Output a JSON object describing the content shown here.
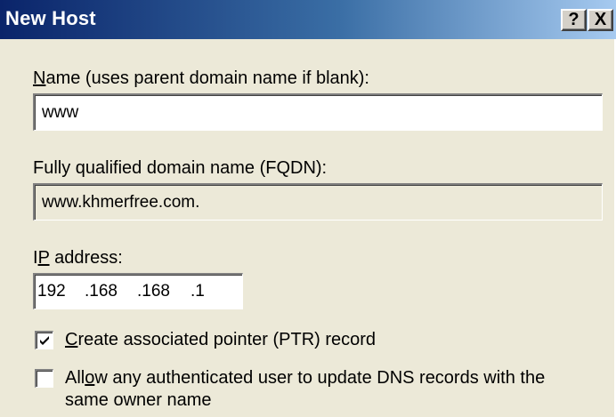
{
  "window": {
    "title": "New Host",
    "help_button": "?",
    "close_button": "X"
  },
  "name_field": {
    "label_mnemonic": "N",
    "label_rest": "ame (uses parent domain name if blank):",
    "value": "www"
  },
  "fqdn_field": {
    "label": "Fully qualified domain name (FQDN):",
    "value": "www.khmerfree.com."
  },
  "ip_field": {
    "label_pre": "I",
    "label_mnemonic": "P",
    "label_rest": " address:",
    "octets": [
      "192",
      ".168",
      ".168",
      ".1"
    ]
  },
  "ptr_checkbox": {
    "checked": true,
    "label_mnemonic": "C",
    "label_rest": "reate associated pointer (PTR) record"
  },
  "update_checkbox": {
    "checked": false,
    "label_pre": "All",
    "label_mnemonic": "o",
    "label_rest": "w any authenticated user to update DNS records with the",
    "label_line2": "same owner name"
  }
}
